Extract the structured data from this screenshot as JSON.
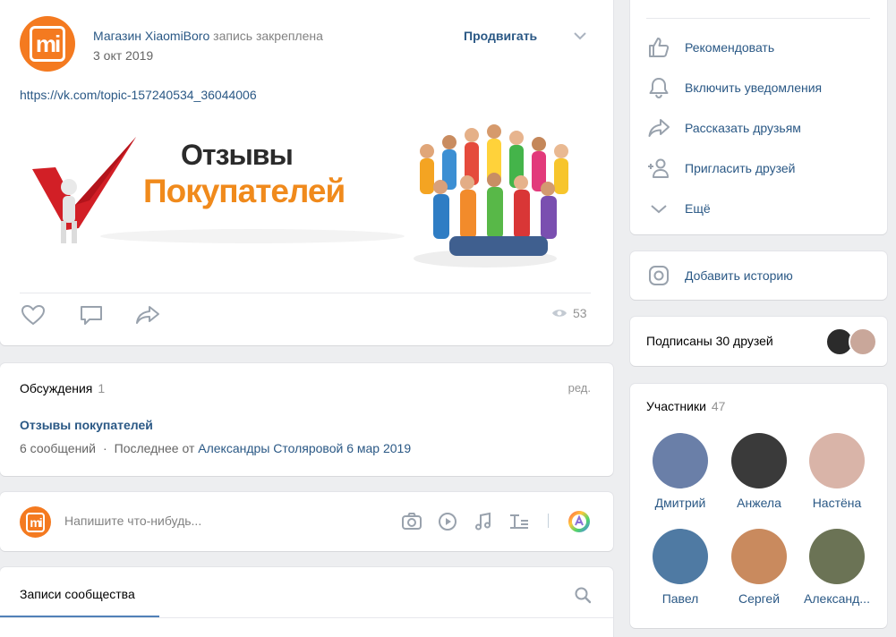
{
  "post": {
    "author": "Магазин XiaomiBoro",
    "pinned_note": "запись закреплена",
    "date": "3 окт 2019",
    "promote_label": "Продвигать",
    "link": "https://vk.com/topic-157240534_36044006",
    "banner_line1": "Отзывы",
    "banner_line2": "Покупателей",
    "views": "53",
    "avatar_text": "mi"
  },
  "discussions": {
    "title": "Обсуждения",
    "count": "1",
    "edit_label": "ред.",
    "topic": "Отзывы покупателей",
    "messages": "6 сообщений",
    "last_prefix": "Последнее от",
    "last_author": "Александры Столяровой",
    "last_date": "6 мар 2019"
  },
  "composer": {
    "placeholder": "Напишите что-нибудь..."
  },
  "feed": {
    "tab_label": "Записи сообщества"
  },
  "menu": {
    "items": [
      {
        "label": "Рекомендовать",
        "icon": "thumbs-up-icon"
      },
      {
        "label": "Включить уведомления",
        "icon": "bell-icon"
      },
      {
        "label": "Рассказать друзьям",
        "icon": "share-icon"
      },
      {
        "label": "Пригласить друзей",
        "icon": "add-user-icon"
      },
      {
        "label": "Ещё",
        "icon": "chevron-down-icon"
      }
    ]
  },
  "story": {
    "label": "Добавить историю"
  },
  "friends": {
    "label": "Подписаны 30 друзей"
  },
  "members": {
    "title": "Участники",
    "count": "47",
    "people": [
      {
        "name": "Дмитрий",
        "color": "#6a7fa8"
      },
      {
        "name": "Анжела",
        "color": "#3a3a3a"
      },
      {
        "name": "Настёна",
        "color": "#d9b4a8"
      },
      {
        "name": "Павел",
        "color": "#4f7aa3"
      },
      {
        "name": "Сергей",
        "color": "#c98a5e"
      },
      {
        "name": "Александ...",
        "color": "#6b7355"
      }
    ]
  },
  "colors": {
    "link": "#2a5885",
    "brand_orange": "#f47a20",
    "accent_blue": "#5181b8"
  }
}
